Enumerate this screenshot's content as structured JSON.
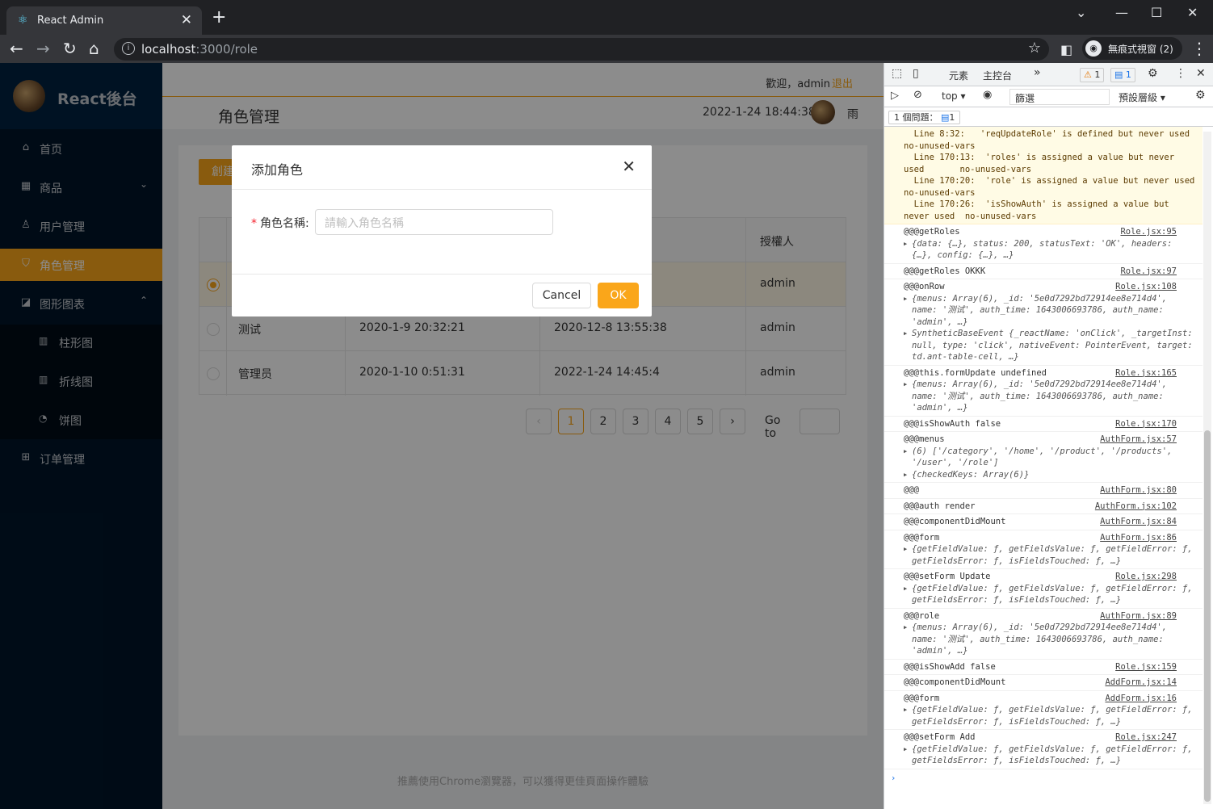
{
  "browser": {
    "tab_title": "React Admin",
    "url_host": "localhost",
    "url_path": ":3000/role",
    "incognito_label": "無痕式視窗 (2)"
  },
  "sidebar": {
    "title": "React後台",
    "items": [
      {
        "label": "首页",
        "icon": "home-icon"
      },
      {
        "label": "商品",
        "icon": "appstore-icon"
      },
      {
        "label": "用户管理",
        "icon": "user-icon"
      },
      {
        "label": "角色管理",
        "icon": "safety-icon"
      },
      {
        "label": "图形图表",
        "icon": "area-chart-icon"
      },
      {
        "label": "订单管理",
        "icon": "windows-icon"
      }
    ],
    "sub_items": [
      {
        "label": "柱形图",
        "icon": "bar-chart-icon"
      },
      {
        "label": "折线图",
        "icon": "line-chart-icon"
      },
      {
        "label": "饼图",
        "icon": "pie-chart-icon"
      }
    ]
  },
  "header": {
    "welcome": "歡迎，admin",
    "logout": "退出",
    "page_title": "角色管理",
    "datetime": "2022-1-24 18:44:38",
    "weather": "雨"
  },
  "content": {
    "create_button": "創建角色",
    "auth_header": "授權人",
    "rows": [
      {
        "name": "",
        "create_time": "",
        "auth_time": "",
        "auth_name": "admin",
        "selected": true
      },
      {
        "name": "测试",
        "create_time": "2020-1-9 20:32:21",
        "auth_time": "2020-12-8 13:55:38",
        "auth_name": "admin",
        "selected": false
      },
      {
        "name": "管理员",
        "create_time": "2020-1-10 0:51:31",
        "auth_time": "2022-1-24 14:45:4",
        "auth_name": "admin",
        "selected": false
      }
    ],
    "pages": [
      "1",
      "2",
      "3",
      "4",
      "5"
    ],
    "goto_label": "Go to",
    "footer": "推薦使用Chrome瀏覽器，可以獲得更佳頁面操作體驗"
  },
  "modal": {
    "title": "添加角色",
    "field_label": "角色名稱:",
    "field_placeholder": "請輸入角色名稱",
    "cancel": "Cancel",
    "ok": "OK"
  },
  "devtools": {
    "tabs": [
      "元素",
      "主控台"
    ],
    "warn_count": "1",
    "info_count": "1",
    "context": "top",
    "filter": "篩選",
    "levels": "預設層級",
    "issues": "1 個問題：",
    "issue_count": "1",
    "warning_text": "  Line 8:32:   'reqUpdateRole' is defined but never used        no-unused-vars\n  Line 170:13:  'roles' is assigned a value but never used       no-unused-vars\n  Line 170:20:  'role' is assigned a value but never used        no-unused-vars\n  Line 170:26:  'isShowAuth' is assigned a value but never used  no-unused-vars",
    "logs": [
      {
        "msg": "@@@getRoles",
        "src": "Role.jsx:95",
        "subs": [
          "{data: {…}, status: 200, statusText: 'OK', headers: {…}, config: {…}, …}"
        ]
      },
      {
        "msg": "@@@getRoles OKKK",
        "src": "Role.jsx:97",
        "subs": []
      },
      {
        "msg": "@@@onRow",
        "src": "Role.jsx:108",
        "subs": [
          "{menus: Array(6), _id: '5e0d7292bd72914ee8e714d4', name: '测试', auth_time: 1643006693786, auth_name: 'admin', …}",
          "SyntheticBaseEvent {_reactName: 'onClick', _targetInst: null, type: 'click', nativeEvent: PointerEvent, target: td.ant-table-cell, …}"
        ]
      },
      {
        "msg": "@@@this.formUpdate undefined",
        "src": "Role.jsx:165",
        "subs": [
          "{menus: Array(6), _id: '5e0d7292bd72914ee8e714d4', name: '测试', auth_time: 1643006693786, auth_name: 'admin', …}"
        ]
      },
      {
        "msg": "@@@isShowAuth false",
        "src": "Role.jsx:170",
        "subs": []
      },
      {
        "msg": "@@@menus",
        "src": "AuthForm.jsx:57",
        "subs": [
          "(6) ['/category', '/home', '/product', '/products', '/user', '/role']",
          "{checkedKeys: Array(6)}"
        ]
      },
      {
        "msg": "@@@",
        "src": "AuthForm.jsx:80",
        "subs": []
      },
      {
        "msg": "@@@auth render",
        "src": "AuthForm.jsx:102",
        "subs": []
      },
      {
        "msg": "@@@componentDidMount",
        "src": "AuthForm.jsx:84",
        "subs": []
      },
      {
        "msg": "@@@form",
        "src": "AuthForm.jsx:86",
        "subs": [
          "{getFieldValue: ƒ, getFieldsValue: ƒ, getFieldError: ƒ, getFieldsError: ƒ, isFieldsTouched: ƒ, …}"
        ]
      },
      {
        "msg": "@@@setForm Update",
        "src": "Role.jsx:298",
        "subs": [
          "{getFieldValue: ƒ, getFieldsValue: ƒ, getFieldError: ƒ, getFieldsError: ƒ, isFieldsTouched: ƒ, …}"
        ]
      },
      {
        "msg": "@@@role",
        "src": "AuthForm.jsx:89",
        "subs": [
          "{menus: Array(6), _id: '5e0d7292bd72914ee8e714d4', name: '测试', auth_time: 1643006693786, auth_name: 'admin', …}"
        ]
      },
      {
        "msg": "@@@isShowAdd false",
        "src": "Role.jsx:159",
        "subs": []
      },
      {
        "msg": "@@@componentDidMount",
        "src": "AddForm.jsx:14",
        "subs": []
      },
      {
        "msg": "@@@form",
        "src": "AddForm.jsx:16",
        "subs": [
          "{getFieldValue: ƒ, getFieldsValue: ƒ, getFieldError: ƒ, getFieldsError: ƒ, isFieldsTouched: ƒ, …}"
        ]
      },
      {
        "msg": "@@@setForm Add",
        "src": "Role.jsx:247",
        "subs": [
          "{getFieldValue: ƒ, getFieldsValue: ƒ, getFieldError: ƒ, getFieldsError: ƒ, isFieldsTouched: ƒ, …}"
        ]
      }
    ]
  },
  "colors": {
    "accent": "#faa61a",
    "sidebar": "#001529"
  }
}
